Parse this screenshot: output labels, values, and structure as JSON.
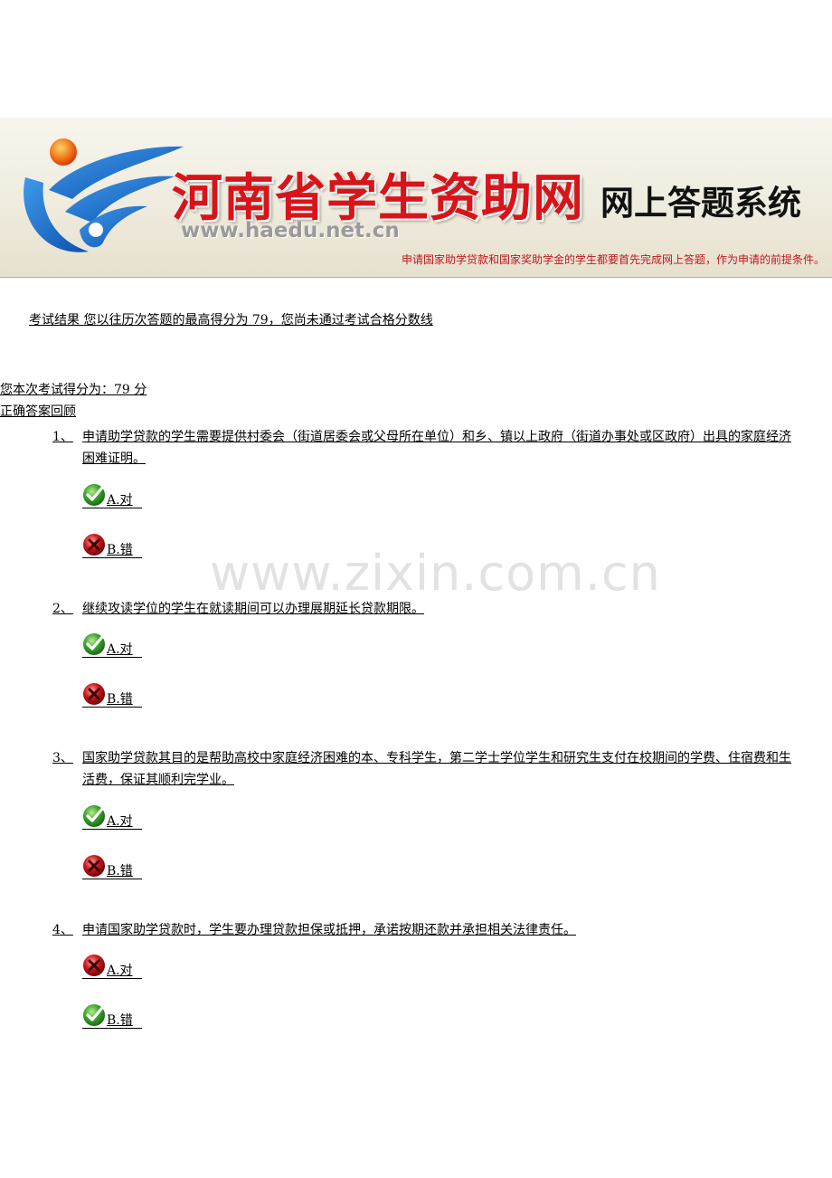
{
  "header": {
    "site_title": "河南省学生资助网",
    "system_title": "网上答题系统",
    "url": "www.haedu.net.cn",
    "notice": "申请国家助学贷款和国家奖助学金的学生都要首先完成网上答题，作为申请的前提条件。"
  },
  "result_line": "考试结果  您以往历次答题的最高得分为 79，您尚未通过考试合格分数线",
  "score_line": "您本次考试得分为：79 分",
  "review_title": "正确答案回顾",
  "questions": [
    {
      "num": "1、",
      "text": "申请助学贷款的学生需要提供村委会（街道居委会或父母所在单位）和乡、镇以上政府（街道办事处或区政府）出具的家庭经济困难证明。",
      "options": [
        {
          "label": "A.对",
          "mark": "check-icon"
        },
        {
          "label": "B.错",
          "mark": "cross-icon"
        }
      ]
    },
    {
      "num": "2、",
      "text": "继续攻读学位的学生在就读期间可以办理展期延长贷款期限。",
      "options": [
        {
          "label": "A.对",
          "mark": "check-icon"
        },
        {
          "label": "B.错",
          "mark": "cross-icon"
        }
      ]
    },
    {
      "num": "3、",
      "text": "国家助学贷款其目的是帮助高校中家庭经济困难的本、专科学生，第二学士学位学生和研究生支付在校期间的学费、住宿费和生活费，保证其顺利完学业。",
      "options": [
        {
          "label": "A.对",
          "mark": "check-icon"
        },
        {
          "label": "B.错",
          "mark": "cross-icon"
        }
      ]
    },
    {
      "num": "4、",
      "text": "申请国家助学贷款时，学生要办理贷款担保或抵押，承诺按期还款并承担相关法律责任。",
      "options": [
        {
          "label": "A.对",
          "mark": "cross-icon"
        },
        {
          "label": "B.错",
          "mark": "check-icon"
        }
      ]
    }
  ],
  "watermark": "www.zixin.com.cn",
  "colors": {
    "brand_red": "#d8141a",
    "check_green": "#3aa12c",
    "cross_red": "#c8141a"
  }
}
